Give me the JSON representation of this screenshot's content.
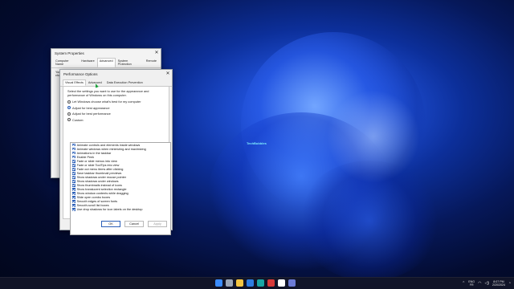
{
  "watermark": "TechBubbles",
  "system_properties": {
    "title": "System Properties",
    "tabs": [
      "Computer Name",
      "Hardware",
      "Advanced",
      "System Protection",
      "Remote"
    ],
    "active_tab": 2,
    "admin_note": "You must be logged on as an Administrator to make most of these changes."
  },
  "performance_options": {
    "title": "Performance Options",
    "tabs": [
      "Visual Effects",
      "Advanced",
      "Data Execution Prevention"
    ],
    "active_tab": 0,
    "description": "Select the settings you want to use for the appearance and performance of Windows on this computer.",
    "radios": [
      {
        "label": "Let Windows choose what's best for my computer",
        "checked": false
      },
      {
        "label": "Adjust for best appearance",
        "checked": true
      },
      {
        "label": "Adjust for best performance",
        "checked": false
      },
      {
        "label": "Custom:",
        "checked": false
      }
    ],
    "effects": [
      "Animate controls and elements inside windows",
      "Animate windows when minimizing and maximizing",
      "Animations in the taskbar",
      "Enable Peek",
      "Fade or slide menus into view",
      "Fade or slide ToolTips into view",
      "Fade out menu items after clicking",
      "Save taskbar thumbnail previews",
      "Show shadows under mouse pointer",
      "Show shadows under windows",
      "Show thumbnails instead of icons",
      "Show translucent selection rectangle",
      "Show window contents while dragging",
      "Slide open combo boxes",
      "Smooth edges of screen fonts",
      "Smooth-scroll list boxes",
      "Use drop shadows for icon labels on the desktop"
    ],
    "buttons": {
      "ok": "OK",
      "cancel": "Cancel",
      "apply": "Apply"
    }
  },
  "taskbar": {
    "lang": "ENG",
    "region": "FR",
    "time": "8:07 PM",
    "date": "2/20/2024",
    "icon_colors": [
      "#3b8cff",
      "#9aa6b8",
      "#f4c542",
      "#2f7de1",
      "#1aa5a5",
      "#d83b3b",
      "#ffffff",
      "#6c7bd6"
    ]
  }
}
